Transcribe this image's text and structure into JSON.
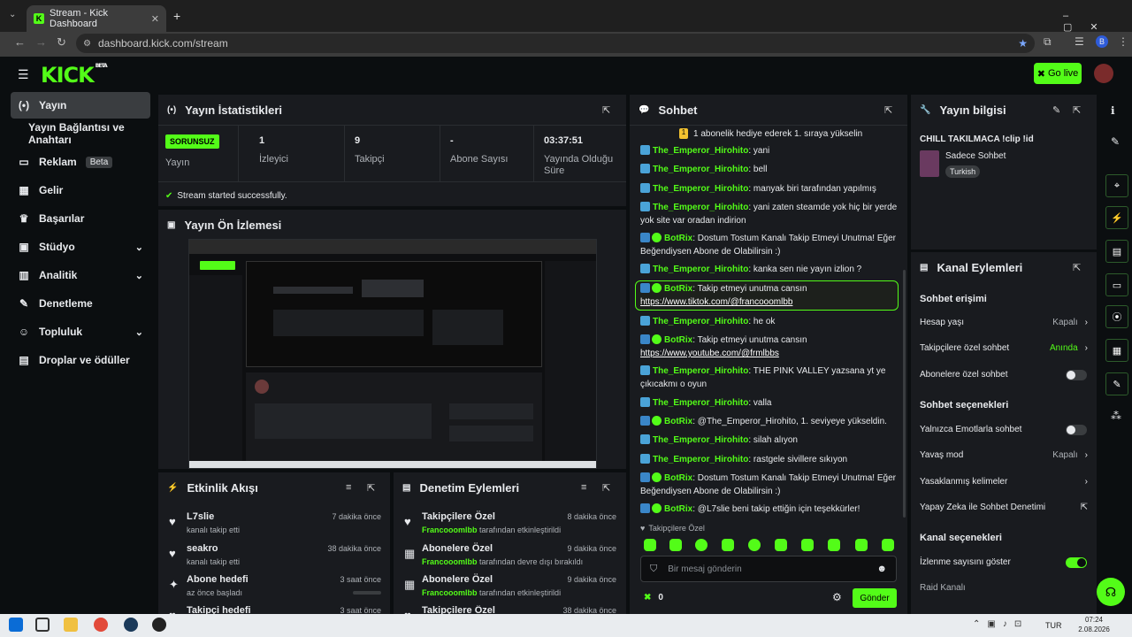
{
  "browser": {
    "tab_title": "Stream - Kick Dashboard",
    "url": "dashboard.kick.com/stream",
    "profile_letter": "B"
  },
  "header": {
    "logo": "KICK",
    "logo_sup": "BETA",
    "go_live": "Go live"
  },
  "sidebar": {
    "items": [
      {
        "label": "Yayın",
        "icon": "broadcast-icon"
      },
      {
        "label": "Yayın Bağlantısı ve Anahtarı"
      },
      {
        "label": "Reklam",
        "badge": "Beta",
        "icon": "ad-icon"
      },
      {
        "label": "Gelir",
        "icon": "revenue-icon"
      },
      {
        "label": "Başarılar",
        "icon": "trophy-icon"
      },
      {
        "label": "Stüdyo",
        "icon": "studio-icon"
      },
      {
        "label": "Analitik",
        "icon": "analytics-icon"
      },
      {
        "label": "Denetleme",
        "icon": "wrench-icon"
      },
      {
        "label": "Topluluk",
        "icon": "community-icon"
      },
      {
        "label": "Droplar ve ödüller",
        "icon": "drops-icon"
      }
    ]
  },
  "stats": {
    "title": "Yayın İstatistikleri",
    "status_badge": "SORUNSUZ",
    "items": [
      {
        "value": "",
        "label": "Yayın"
      },
      {
        "value": "1",
        "label": "İzleyici"
      },
      {
        "value": "9",
        "label": "Takipçi"
      },
      {
        "value": "-",
        "label": "Abone Sayısı"
      },
      {
        "value": "03:37:51",
        "label": "Yayında Olduğu Süre"
      }
    ],
    "success": "Stream started successfully."
  },
  "preview": {
    "title": "Yayın Ön İzlemesi"
  },
  "activity": {
    "title": "Etkinlik Akışı",
    "rows": [
      {
        "name": "L7slie",
        "sub": "kanalı takip etti",
        "time": "7 dakika önce"
      },
      {
        "name": "seakro",
        "sub": "kanalı takip etti",
        "time": "38 dakika önce"
      },
      {
        "name": "Abone hedefi",
        "sub": "az önce başladı",
        "time": "3 saat önce"
      },
      {
        "name": "Takipçi hedefi",
        "sub": "",
        "time": "3 saat önce"
      }
    ]
  },
  "moderation": {
    "title": "Denetim Eylemleri",
    "rows": [
      {
        "name": "Takipçilere Özel",
        "user": "Francooomlbb",
        "sub": "tarafından etkinleştirildi",
        "time": "8 dakika önce"
      },
      {
        "name": "Abonelere Özel",
        "user": "Francooomlbb",
        "sub": "tarafından devre dışı bırakıldı",
        "time": "9 dakika önce"
      },
      {
        "name": "Abonelere Özel",
        "user": "Francooomlbb",
        "sub": "tarafından etkinleştirildi",
        "time": "9 dakika önce"
      },
      {
        "name": "Takipçilere Özel",
        "user": "",
        "sub": "",
        "time": "38 dakika önce"
      }
    ]
  },
  "chat": {
    "title": "Sohbet",
    "pinned": "1 abonelik hediye ederek 1. sıraya yükselin",
    "messages": [
      {
        "user": "The_Emperor_Hirohito",
        "text": "yani"
      },
      {
        "user": "The_Emperor_Hirohito",
        "text": "bell"
      },
      {
        "user": "The_Emperor_Hirohito",
        "text": "manyak biri tarafından yapılmış"
      },
      {
        "user": "The_Emperor_Hirohito",
        "text": "yani zaten steamde yok hiç bir yerde yok site var oradan indirion"
      },
      {
        "user": "BotRix",
        "text": "Dostum Tostum Kanalı Takip Etmeyi Unutma! Eğer Beğendiysen Abone de Olabilirsin :)"
      },
      {
        "user": "The_Emperor_Hirohito",
        "text": "kanka sen nie yayın izlion ?"
      },
      {
        "user": "BotRix",
        "text": "Takip etmeyi unutma cansın",
        "link": "https://www.tiktok.com/@francooomlbb"
      },
      {
        "user": "The_Emperor_Hirohito",
        "text": "he ok"
      },
      {
        "user": "BotRix",
        "text": "Takip etmeyi unutma cansın",
        "link": "https://www.youtube.com/@frmlbbs"
      },
      {
        "user": "The_Emperor_Hirohito",
        "text": "THE PINK VALLEY yazsana yt ye çıkıcakmı o oyun"
      },
      {
        "user": "The_Emperor_Hirohito",
        "text": "valla"
      },
      {
        "user": "BotRix",
        "text": "@The_Emperor_Hirohito, 1. seviyeye yükseldin."
      },
      {
        "user": "The_Emperor_Hirohito",
        "text": "silah alıyon"
      },
      {
        "user": "The_Emperor_Hirohito",
        "text": "rastgele sivillere sıkıyon"
      },
      {
        "user": "BotRix",
        "text": "Dostum Tostum Kanalı Takip Etmeyi Unutma! Eğer Beğendiysen Abone de Olabilirsin :)"
      },
      {
        "user": "BotRix",
        "text": "@L7slie beni takip ettiğin için teşekkürler!"
      }
    ],
    "emote_label": "Takipçilere Özel",
    "input_placeholder": "Bir mesaj gönderin",
    "points": "0",
    "send": "Gönder"
  },
  "stream_info": {
    "title": "Yayın bilgisi",
    "stream_title": "CHILL TAKILMACA !clip !id",
    "category": "Sadece Sohbet",
    "language": "Turkish"
  },
  "channel_actions": {
    "title": "Kanal Eylemleri",
    "chat_access": "Sohbet erişimi",
    "account_age": "Hesap yaşı",
    "account_age_val": "Kapalı",
    "followers_only": "Takipçilere özel sohbet",
    "followers_only_val": "Anında",
    "subs_only": "Abonelere özel sohbet",
    "chat_options": "Sohbet seçenekleri",
    "emote_only": "Yalnızca Emotlarla sohbet",
    "slow_mode": "Yavaş mod",
    "slow_mode_val": "Kapalı",
    "banned_words": "Yasaklanmış kelimeler",
    "ai_moderation": "Yapay Zeka ile Sohbet Denetimi",
    "channel_options": "Kanal seçenekleri",
    "show_viewers": "İzlenme sayısını göster",
    "raid": "Raid Kanalı"
  },
  "taskbar": {
    "lang": "TUR",
    "time": "07:24",
    "date": "2.08.2026"
  },
  "colors": {
    "accent": "#53fc18",
    "panel": "#191b1f",
    "bg": "#0b0e10"
  }
}
